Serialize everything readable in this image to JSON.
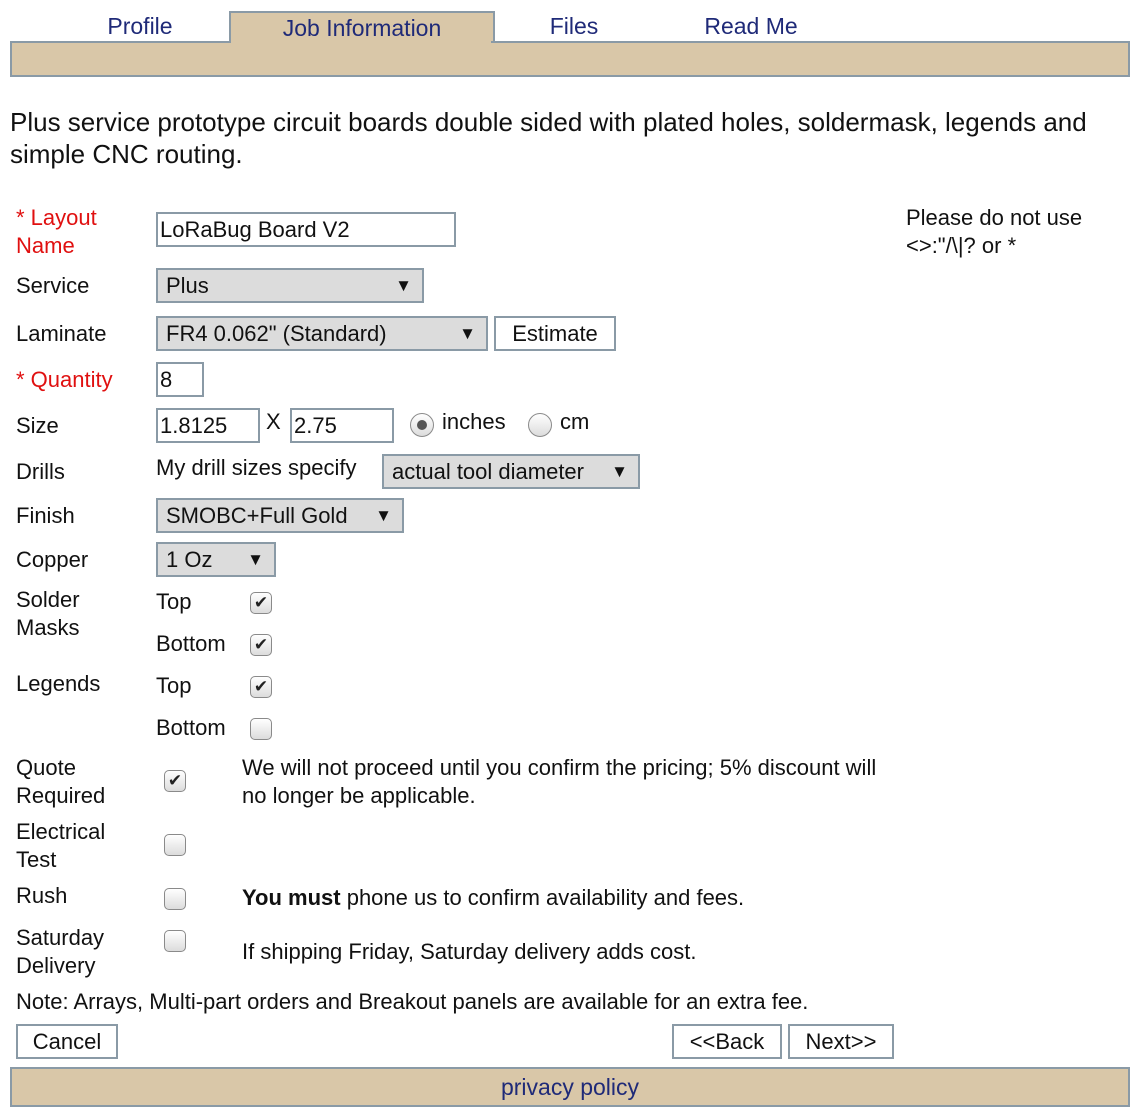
{
  "tabs": [
    "Profile",
    "Job Information",
    "Files",
    "Read Me"
  ],
  "intro": "Plus service prototype circuit boards double sided with plated holes, soldermask, legends and simple CNC routing.",
  "form": {
    "layout_name_label": "* Layout Name",
    "layout_name_value": "LoRaBug Board V2",
    "layout_name_hint": "Please do not use <>:\"/\\|? or *",
    "service_label": "Service",
    "service_value": "Plus",
    "laminate_label": "Laminate",
    "laminate_value": "FR4 0.062\" (Standard)",
    "estimate_button": "Estimate",
    "quantity_label": "* Quantity",
    "quantity_value": "8",
    "size_label": "Size",
    "size_w": "1.8125",
    "size_x": "X",
    "size_h": "2.75",
    "unit_inches": "inches",
    "unit_cm": "cm",
    "drills_label": "Drills",
    "drills_text": "My drill sizes specify",
    "drills_value": "actual tool diameter",
    "finish_label": "Finish",
    "finish_value": "SMOBC+Full Gold",
    "copper_label": "Copper",
    "copper_value": "1 Oz",
    "solder_label": "Solder Masks",
    "legends_label": "Legends",
    "top": "Top",
    "bottom": "Bottom",
    "quote_label": "Quote Required",
    "quote_note": "We will not proceed until you confirm the pricing; 5% discount will no longer be applicable.",
    "etest_label": "Electrical Test",
    "rush_label": "Rush",
    "rush_bold": "You must",
    "rush_note": " phone us to confirm availability and fees.",
    "saturday_label": "Saturday Delivery",
    "saturday_note": "If shipping Friday, Saturday delivery adds cost.",
    "note": "Note: Arrays, Multi-part orders and Breakout panels are available for an extra fee."
  },
  "buttons": {
    "cancel": "Cancel",
    "back": "<<Back",
    "next": "Next>>"
  },
  "footer": {
    "privacy": "privacy policy"
  },
  "colors": {
    "band": "#d9c7a8",
    "link": "#1f2a78",
    "required": "#e01010"
  }
}
